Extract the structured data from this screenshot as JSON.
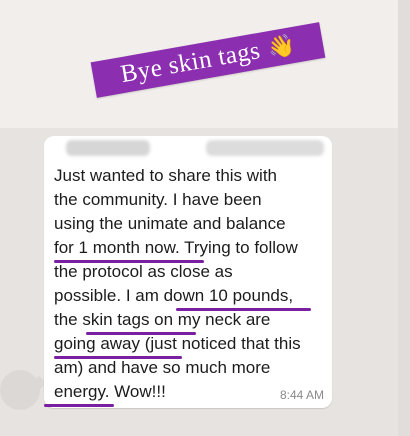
{
  "banner": {
    "text": "Bye skin tags",
    "emoji": "👋",
    "color": "#8b2fb0"
  },
  "message": {
    "sender_name": "",
    "sender_phone": "",
    "text": "Just wanted to share this with\nthe community.  I have been\nusing the unimate and balance\nfor 1 month now.  Trying to follow\nthe protocol as close as\npossible.  I am down 10 pounds,\nthe skin tags on my neck are\ngoing away (just noticed that this\nam) and have so much more\nenergy.  Wow!!!",
    "time": "8:44 AM"
  },
  "highlight_color": "#7a1fa2"
}
